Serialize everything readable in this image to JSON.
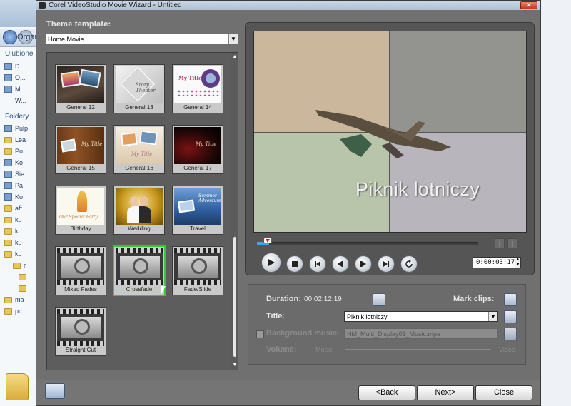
{
  "background": {
    "organize": "Organ",
    "favorites_header": "Ulubione",
    "favorites": [
      "D...",
      "O...",
      "M...",
      "W..."
    ],
    "folders_header": "Foldery",
    "folders": [
      "Pulp",
      "Lea",
      "Pu",
      "Ko",
      "Sie",
      "Pa",
      "Ko",
      "aft",
      "ku",
      "ku",
      "ku",
      "ku",
      "r",
      "",
      "",
      "ma",
      "pc"
    ]
  },
  "window": {
    "title": "Corel VideoStudio Movie Wizard - Untitled",
    "close": "✕"
  },
  "theme": {
    "label": "Theme template:",
    "selected": "Home Movie"
  },
  "templates": [
    {
      "name": "General 12"
    },
    {
      "name": "General 13",
      "art": "Story Theater"
    },
    {
      "name": "General 14",
      "art": "My Title"
    },
    {
      "name": "General 15",
      "art": "My Title"
    },
    {
      "name": "General 16",
      "art": "My Title"
    },
    {
      "name": "General 17",
      "art": "My Title"
    },
    {
      "name": "Birthday",
      "art": "Our Special Party"
    },
    {
      "name": "Wedding"
    },
    {
      "name": "Travel",
      "art": "Summer Adventure"
    },
    {
      "name": "Mixed Fades"
    },
    {
      "name": "Crossfade"
    },
    {
      "name": "Fade/Slide"
    },
    {
      "name": "Straight Cut"
    }
  ],
  "selected_template": "Crossfade",
  "preview": {
    "title_text": "Piknik lotniczy",
    "timecode": "0:00:03:17",
    "position_fraction": 0.03
  },
  "settings": {
    "duration_label": "Duration:",
    "duration_value": "00:02:12:19",
    "mark_clips_label": "Mark clips:",
    "title_label": "Title:",
    "title_value": "Piknik lotniczy",
    "bg_music_label": "Background music:",
    "bg_music_value": "HM_Multi_Display01_Music.mpa",
    "volume_label": "Volume:",
    "music_label": "Music",
    "video_label": "Video"
  },
  "footer": {
    "back": "<Back",
    "next": "Next>",
    "close": "Close"
  }
}
